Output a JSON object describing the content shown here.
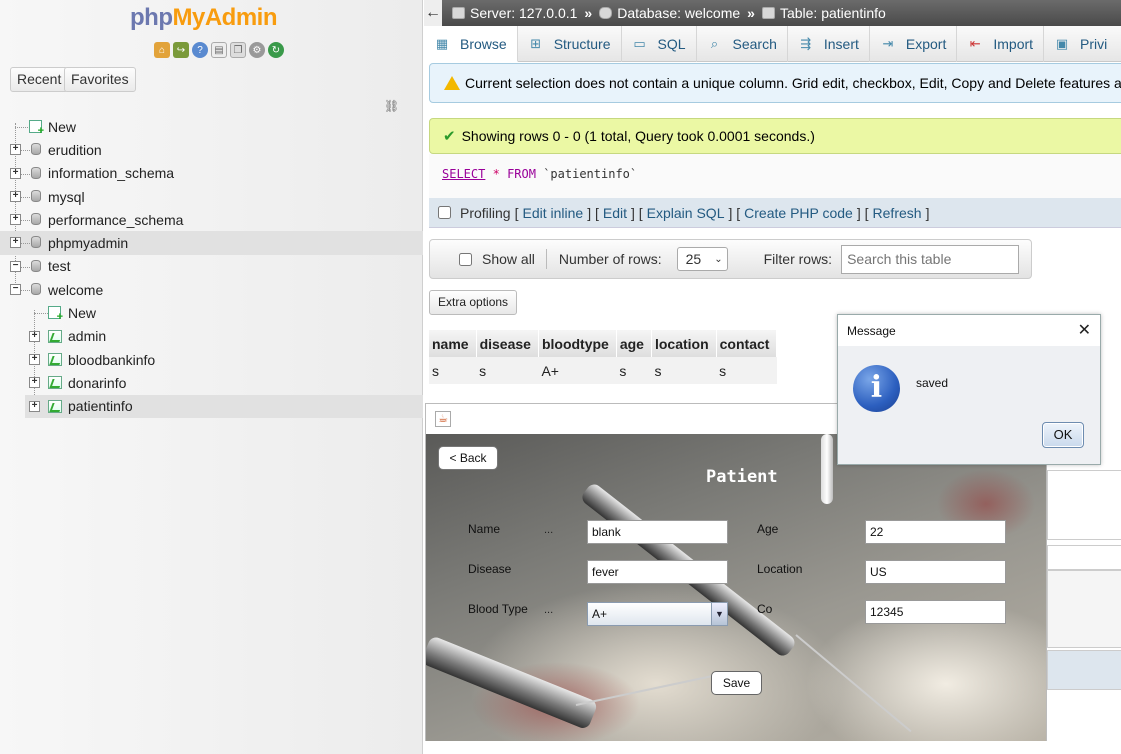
{
  "logo": {
    "part1": "php",
    "part2": "MyAdmin"
  },
  "nav_tabs": {
    "recent": "Recent",
    "favorites": "Favorites"
  },
  "tree": {
    "new_label": "New",
    "databases": [
      "erudition",
      "information_schema",
      "mysql",
      "performance_schema",
      "phpmyadmin",
      "test",
      "welcome"
    ],
    "welcome_children": [
      "New",
      "admin",
      "bloodbankinfo",
      "donarinfo",
      "patientinfo"
    ]
  },
  "breadcrumb": {
    "server": "Server: 127.0.0.1",
    "database": "Database: welcome",
    "table": "Table: patientinfo"
  },
  "tabs": [
    "Browse",
    "Structure",
    "SQL",
    "Search",
    "Insert",
    "Export",
    "Import",
    "Privi"
  ],
  "warning": "Current selection does not contain a unique column. Grid edit, checkbox, Edit, Copy and Delete features are not a",
  "success": "Showing rows 0 - 0 (1 total, Query took 0.0001 seconds.)",
  "sql": {
    "select": "SELECT",
    "star": "*",
    "from": "FROM",
    "table": "`patientinfo`"
  },
  "profiling": {
    "label": "Profiling",
    "links": [
      "Edit inline",
      "Edit",
      "Explain SQL",
      "Create PHP code",
      "Refresh"
    ]
  },
  "navbar": {
    "show_all": "Show all",
    "rows_label": "Number of rows:",
    "rows_value": "25",
    "filter_label": "Filter rows:",
    "filter_placeholder": "Search this table"
  },
  "extra_options": "Extra options",
  "results": {
    "columns": [
      "name",
      "disease",
      "bloodtype",
      "age",
      "location",
      "contact"
    ],
    "rows": [
      [
        "s",
        "s",
        "A+",
        "s",
        "s",
        "s"
      ]
    ]
  },
  "form": {
    "back": "< Back",
    "title": "Patient",
    "name_label": "Name",
    "name_value": "blank",
    "age_label": "Age",
    "age_value": "22",
    "disease_label": "Disease",
    "disease_value": "fever",
    "location_label": "Location",
    "location_value": "US",
    "blood_label": "Blood Type",
    "blood_value": "A+",
    "contact_label": "Co",
    "contact_value": "12345",
    "dots": "...",
    "save": "Save"
  },
  "dialog": {
    "title": "Message",
    "message": "saved",
    "ok": "OK"
  },
  "colors": {
    "link": "#235a81",
    "accent": "#f89c0e",
    "success_bg": "#ebf8a4"
  }
}
